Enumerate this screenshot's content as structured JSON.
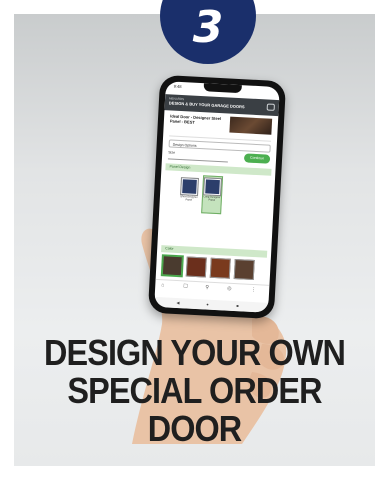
{
  "step": {
    "number": "3"
  },
  "phone": {
    "status_time": "9:48",
    "app_brand": "MENARDS",
    "app_title": "DESIGN & BUY YOUR GARAGE DOORS",
    "product_title": "Ideal Door - Designer Steel Panel - BEST",
    "options_label": "Design Options",
    "qty_label": "Size",
    "continue_label": "Continue",
    "panel_section": "Panel Design",
    "tiles": [
      "Short Designer Panel",
      "Long Designer Panel"
    ],
    "color_section": "Color",
    "toolbar_icons": [
      "home-icon",
      "bookmark-icon",
      "search-icon",
      "cart-icon",
      "menu-icon"
    ],
    "nav_icons": [
      "back-icon",
      "home-circle-icon",
      "square-icon"
    ]
  },
  "headline": {
    "line1": "DESIGN YOUR OWN",
    "line2": "SPECIAL ORDER",
    "line3": "DOOR"
  },
  "colors": {
    "badge": "#1a2f6b",
    "accent_green": "#4caf50",
    "headline": "#1f1f1f"
  }
}
